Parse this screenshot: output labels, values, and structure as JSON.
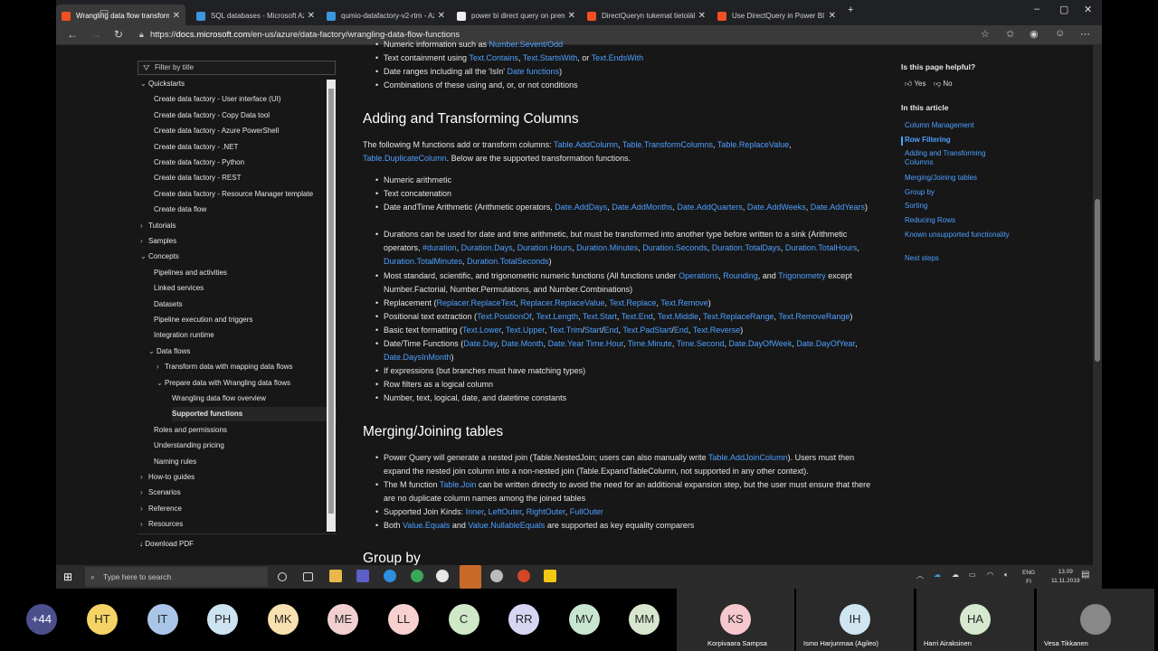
{
  "browser": {
    "tabs": [
      {
        "title": "Wrangling data flow transformat",
        "color": "#f25022"
      },
      {
        "title": "SQL databases - Microsoft Azure",
        "color": "#3a96dd"
      },
      {
        "title": "qumio-datafactory-v2-rtm - Azu",
        "color": "#3a96dd"
      },
      {
        "title": "power bi direct query on premis",
        "color": "#eeeeee"
      },
      {
        "title": "DirectQueryn tukemat tietolähte",
        "color": "#f25022"
      },
      {
        "title": "Use DirectQuery in Power BI De",
        "color": "#f25022"
      }
    ],
    "url_prefix": "https://",
    "url_host": "docs.microsoft.com",
    "url_path": "/en-us/azure/data-factory/wrangling-data-flow-functions"
  },
  "toc": {
    "filter_placeholder": "Filter by title",
    "items": [
      {
        "label": "Quickstarts",
        "caret": "⌄",
        "indent": 0
      },
      {
        "label": "Create data factory - User interface (UI)",
        "caret": "",
        "indent": 2
      },
      {
        "label": "Create data factory - Copy Data tool",
        "caret": "",
        "indent": 2
      },
      {
        "label": "Create data factory - Azure PowerShell",
        "caret": "",
        "indent": 2
      },
      {
        "label": "Create data factory - .NET",
        "caret": "",
        "indent": 2
      },
      {
        "label": "Create data factory - Python",
        "caret": "",
        "indent": 2
      },
      {
        "label": "Create data factory - REST",
        "caret": "",
        "indent": 2
      },
      {
        "label": "Create data factory - Resource Manager template",
        "caret": "",
        "indent": 2
      },
      {
        "label": "Create data flow",
        "caret": "",
        "indent": 2
      },
      {
        "label": "Tutorials",
        "caret": "›",
        "indent": 0
      },
      {
        "label": "Samples",
        "caret": "›",
        "indent": 0
      },
      {
        "label": "Concepts",
        "caret": "⌄",
        "indent": 0
      },
      {
        "label": "Pipelines and activities",
        "caret": "",
        "indent": 2
      },
      {
        "label": "Linked services",
        "caret": "",
        "indent": 2
      },
      {
        "label": "Datasets",
        "caret": "",
        "indent": 2
      },
      {
        "label": "Pipeline execution and triggers",
        "caret": "",
        "indent": 2
      },
      {
        "label": "Integration runtime",
        "caret": "",
        "indent": 2
      },
      {
        "label": "Data flows",
        "caret": "⌄",
        "indent": 1
      },
      {
        "label": "Transform data with mapping data flows",
        "caret": "›",
        "indent": 2
      },
      {
        "label": "Prepare data with Wrangling data flows",
        "caret": "⌄",
        "indent": 2
      },
      {
        "label": "Wrangling data flow overview",
        "caret": "",
        "indent": 4
      },
      {
        "label": "Supported functions",
        "caret": "",
        "indent": 4,
        "selected": true
      },
      {
        "label": "Roles and permissions",
        "caret": "",
        "indent": 2
      },
      {
        "label": "Understanding pricing",
        "caret": "",
        "indent": 2
      },
      {
        "label": "Naming rules",
        "caret": "",
        "indent": 2
      },
      {
        "label": "How-to guides",
        "caret": "›",
        "indent": 0
      },
      {
        "label": "Scenarios",
        "caret": "›",
        "indent": 0
      },
      {
        "label": "Reference",
        "caret": "›",
        "indent": 0
      },
      {
        "label": "Resources",
        "caret": "›",
        "indent": 0
      }
    ],
    "download_pdf": "Download PDF"
  },
  "article": {
    "top_items": [
      [
        {
          "t": "Numeric information such as "
        },
        {
          "t": "Number.Sevent/Odd",
          "l": 1
        }
      ],
      [
        {
          "t": "Text containment using "
        },
        {
          "t": "Text.Contains",
          "l": 1
        },
        {
          "t": ", "
        },
        {
          "t": "Text.StartsWith",
          "l": 1
        },
        {
          "t": ", or "
        },
        {
          "t": "Text.EndsWith",
          "l": 1
        }
      ],
      [
        {
          "t": "Date ranges including all the 'IsIn' "
        },
        {
          "t": "Date functions",
          "l": 1
        },
        {
          "t": ")"
        }
      ],
      [
        {
          "t": "Combinations of these using and, or, or not conditions"
        }
      ]
    ],
    "h_adding": "Adding and Transforming Columns",
    "intro": [
      {
        "t": "The following M functions add or transform columns: "
      },
      {
        "t": "Table.AddColumn",
        "l": 1
      },
      {
        "t": ", "
      },
      {
        "t": "Table.TransformColumns",
        "l": 1
      },
      {
        "t": ", "
      },
      {
        "t": "Table.ReplaceValue",
        "l": 1
      },
      {
        "t": ", "
      },
      {
        "t": "Table.DuplicateColumn",
        "l": 1
      },
      {
        "t": ". Below are the supported transformation functions."
      }
    ],
    "transform_items": [
      [
        {
          "t": "Numeric arithmetic"
        }
      ],
      [
        {
          "t": "Text concatenation"
        }
      ],
      [
        {
          "t": "Date andTime Arithmetic (Arithmetic operators, "
        },
        {
          "t": "Date.AddDays",
          "l": 1
        },
        {
          "t": ", "
        },
        {
          "t": "Date.AddMonths",
          "l": 1
        },
        {
          "t": ", "
        },
        {
          "t": "Date.AddQuarters",
          "l": 1
        },
        {
          "t": ", "
        },
        {
          "t": "Date.AddWeeks",
          "l": 1
        },
        {
          "t": ", "
        },
        {
          "t": "Date.AddYears",
          "l": 1
        },
        {
          "t": ")"
        }
      ],
      [
        {
          "t": "Durations can be used for date and time arithmetic, but must be transformed into another type before written to a sink (Arithmetic operators, "
        },
        {
          "t": "#duration",
          "l": 1
        },
        {
          "t": ", "
        },
        {
          "t": "Duration.Days",
          "l": 1
        },
        {
          "t": ", "
        },
        {
          "t": "Duration.Hours",
          "l": 1
        },
        {
          "t": ", "
        },
        {
          "t": "Duration.Minutes",
          "l": 1
        },
        {
          "t": ", "
        },
        {
          "t": "Duration.Seconds",
          "l": 1
        },
        {
          "t": ", "
        },
        {
          "t": "Duration.TotalDays",
          "l": 1
        },
        {
          "t": ", "
        },
        {
          "t": "Duration.TotalHours",
          "l": 1
        },
        {
          "t": ", "
        },
        {
          "t": "Duration.TotalMinutes",
          "l": 1
        },
        {
          "t": ", "
        },
        {
          "t": "Duration.TotalSeconds",
          "l": 1
        },
        {
          "t": ")"
        }
      ],
      [
        {
          "t": "Most standard, scientific, and trigonometric numeric functions (All functions under "
        },
        {
          "t": "Operations",
          "l": 1
        },
        {
          "t": ", "
        },
        {
          "t": "Rounding",
          "l": 1
        },
        {
          "t": ", and "
        },
        {
          "t": "Trigonometry",
          "l": 1
        },
        {
          "t": " except Number.Factorial, Number.Permutations, and Number.Combinations)"
        }
      ],
      [
        {
          "t": "Replacement ("
        },
        {
          "t": "Replacer.ReplaceText",
          "l": 1
        },
        {
          "t": ", "
        },
        {
          "t": "Replacer.ReplaceValue",
          "l": 1
        },
        {
          "t": ", "
        },
        {
          "t": "Text.Replace",
          "l": 1
        },
        {
          "t": ", "
        },
        {
          "t": "Text.Remove",
          "l": 1
        },
        {
          "t": ")"
        }
      ],
      [
        {
          "t": "Positional text extraction ("
        },
        {
          "t": "Text.PositionOf",
          "l": 1
        },
        {
          "t": ", "
        },
        {
          "t": "Text.Length",
          "l": 1
        },
        {
          "t": ", "
        },
        {
          "t": "Text.Start",
          "l": 1
        },
        {
          "t": ", "
        },
        {
          "t": "Text.End",
          "l": 1
        },
        {
          "t": ", "
        },
        {
          "t": "Text.Middle",
          "l": 1
        },
        {
          "t": ", "
        },
        {
          "t": "Text.ReplaceRange",
          "l": 1
        },
        {
          "t": ", "
        },
        {
          "t": "Text.RemoveRange",
          "l": 1
        },
        {
          "t": ")"
        }
      ],
      [
        {
          "t": "Basic text formatting ("
        },
        {
          "t": "Text.Lower",
          "l": 1
        },
        {
          "t": ", "
        },
        {
          "t": "Text.Upper",
          "l": 1
        },
        {
          "t": ", "
        },
        {
          "t": "Text.Trim",
          "l": 1
        },
        {
          "t": "/"
        },
        {
          "t": "Start",
          "l": 1
        },
        {
          "t": "/"
        },
        {
          "t": "End",
          "l": 1
        },
        {
          "t": ", "
        },
        {
          "t": "Text.PadStart",
          "l": 1
        },
        {
          "t": "/"
        },
        {
          "t": "End",
          "l": 1
        },
        {
          "t": ", "
        },
        {
          "t": "Text.Reverse",
          "l": 1
        },
        {
          "t": ")"
        }
      ],
      [
        {
          "t": "Date/Time Functions ("
        },
        {
          "t": "Date.Day",
          "l": 1
        },
        {
          "t": ", "
        },
        {
          "t": "Date.Month",
          "l": 1
        },
        {
          "t": ", "
        },
        {
          "t": "Date.Year",
          "l": 1
        },
        {
          "t": " "
        },
        {
          "t": "Time.Hour",
          "l": 1
        },
        {
          "t": ", "
        },
        {
          "t": "Time.Minute",
          "l": 1
        },
        {
          "t": ", "
        },
        {
          "t": "Time.Second",
          "l": 1
        },
        {
          "t": ", "
        },
        {
          "t": "Date.DayOfWeek",
          "l": 1
        },
        {
          "t": ", "
        },
        {
          "t": "Date.DayOfYear",
          "l": 1
        },
        {
          "t": ", "
        },
        {
          "t": "Date.DaysInMonth",
          "l": 1
        },
        {
          "t": ")"
        }
      ],
      [
        {
          "t": "If expressions (but branches must have matching types)"
        }
      ],
      [
        {
          "t": "Row filters as a logical column"
        }
      ],
      [
        {
          "t": "Number, text, logical, date, and datetime constants"
        }
      ]
    ],
    "h_merging": "Merging/Joining tables",
    "merge_items": [
      [
        {
          "t": "Power Query will generate a nested join (Table.NestedJoin; users can also manually write "
        },
        {
          "t": "Table.AddJoinColumn",
          "l": 1
        },
        {
          "t": "). Users must then expand the nested join column into a non-nested join (Table.ExpandTableColumn, not supported in any other context)."
        }
      ],
      [
        {
          "t": "The M function "
        },
        {
          "t": "Table.Join",
          "l": 1
        },
        {
          "t": " can be written directly to avoid the need for an additional expansion step, but the user must ensure that there are no duplicate column names among the joined tables"
        }
      ],
      [
        {
          "t": "Supported Join Kinds: "
        },
        {
          "t": "Inner",
          "l": 1
        },
        {
          "t": ", "
        },
        {
          "t": "LeftOuter",
          "l": 1
        },
        {
          "t": ", "
        },
        {
          "t": "RightOuter",
          "l": 1
        },
        {
          "t": ", "
        },
        {
          "t": "FullOuter",
          "l": 1
        }
      ],
      [
        {
          "t": "Both "
        },
        {
          "t": "Value.Equals",
          "l": 1
        },
        {
          "t": " and "
        },
        {
          "t": "Value.NullableEquals",
          "l": 1
        },
        {
          "t": " are supported as key equality comparers"
        }
      ]
    ],
    "h_group": "Group by"
  },
  "rail": {
    "helpful": "Is this page helpful?",
    "yes": "Yes",
    "no": "No",
    "in_article": "In this article",
    "links": [
      "Column Management",
      "Row Filtering",
      "Adding and Transforming Columns",
      "Merging/Joining tables",
      "Group by",
      "Sorting",
      "Reducing Rows",
      "Known unsupported functionality",
      "Next steps"
    ],
    "current": 1
  },
  "taskbar": {
    "search_placeholder": "Type here to search",
    "lang": "ENG",
    "region": "FI",
    "time": "13.09",
    "date": "11.11.2019"
  },
  "participants": {
    "more_count": "+44",
    "avatars": [
      {
        "initials": "HT",
        "color": "#f6d365"
      },
      {
        "initials": "IT",
        "color": "#a9c6e8"
      },
      {
        "initials": "PH",
        "color": "#cde3f0"
      },
      {
        "initials": "MK",
        "color": "#f8e0b0"
      },
      {
        "initials": "ME",
        "color": "#f2d0d0"
      },
      {
        "initials": "LL",
        "color": "#f8d0cf"
      },
      {
        "initials": "C",
        "color": "#cfe8c8"
      },
      {
        "initials": "RR",
        "color": "#d6d6f2"
      },
      {
        "initials": "MV",
        "color": "#c8e6cf"
      },
      {
        "initials": "MM",
        "color": "#d8e6cf"
      }
    ],
    "tiles": [
      {
        "initials": "KS",
        "color": "#f6c7cd",
        "name": "Korpivaara Sampsa"
      },
      {
        "initials": "IH",
        "color": "#cfe6f2",
        "name": "Ismo Harjunmaa (Agileo)"
      },
      {
        "initials": "HA",
        "color": "#d6e8cf",
        "name": "Harri Airaksinen"
      },
      {
        "initials": "",
        "color": "#888888",
        "name": "Vesa Tikkanen"
      }
    ]
  }
}
